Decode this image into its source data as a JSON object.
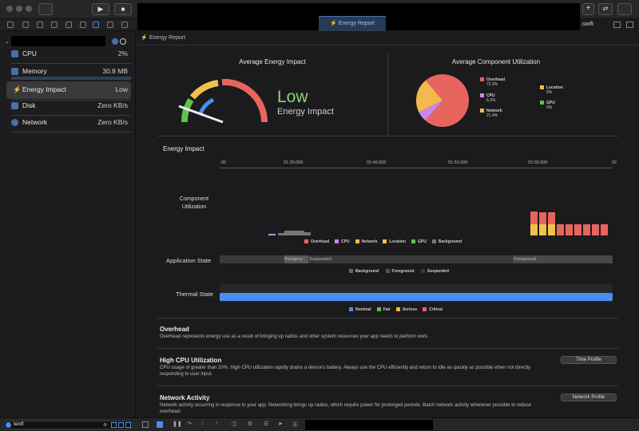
{
  "toolbar": {
    "active_tab": "Energy Report",
    "file_suffix": ".swift"
  },
  "header": {
    "title": "Energy Report"
  },
  "sidebar": {
    "gauges": [
      {
        "label": "CPU",
        "value": "2%"
      },
      {
        "label": "Memory",
        "value": "30.8 MB"
      },
      {
        "label": "Energy Impact",
        "value": "Low"
      },
      {
        "label": "Disk",
        "value": "Zero KB/s"
      },
      {
        "label": "Network",
        "value": "Zero KB/s"
      }
    ],
    "filter_text": "textf"
  },
  "avg_energy": {
    "title": "Average Energy Impact",
    "level": "Low",
    "caption": "Energy Impact"
  },
  "avg_component": {
    "title": "Average Component Utilization",
    "legend": [
      {
        "name": "Overhead",
        "pct": "72.3%",
        "color": "#e8655d"
      },
      {
        "name": "Location",
        "pct": "0%",
        "color": "#f0c24a"
      },
      {
        "name": "CPU",
        "pct": "6.3%",
        "color": "#c985f0"
      },
      {
        "name": "GPU",
        "pct": "0%",
        "color": "#5fc24f"
      },
      {
        "name": "Network",
        "pct": "21.4%",
        "color": "#f3b94f"
      }
    ]
  },
  "chart_data": {
    "type": "pie",
    "title": "Average Component Utilization",
    "categories": [
      "Overhead",
      "CPU",
      "Network",
      "Location",
      "GPU"
    ],
    "values": [
      72.3,
      6.3,
      21.4,
      0,
      0
    ]
  },
  "timeline": {
    "title": "Energy Impact",
    "ticks": [
      "-00",
      "01:30.000",
      "01:40.000",
      "01:50.000",
      "02:00.000",
      "02"
    ],
    "component_label": "Component Utilization",
    "component_legend": [
      "Overhead",
      "CPU",
      "Network",
      "Location",
      "GPU",
      "Background"
    ],
    "app_state_label": "Application State",
    "app_state_segments": [
      "Backgrou",
      "Suspended",
      "Foreground"
    ],
    "app_state_legend": [
      "Background",
      "Foreground",
      "Suspended"
    ],
    "thermal_label": "Thermal State",
    "thermal_legend": [
      "Nominal",
      "Fair",
      "Serious",
      "Critical"
    ]
  },
  "descriptions": [
    {
      "title": "Overhead",
      "text": "Overhead represents energy use as a result of bringing up radios and other system resources your app needs to perform work.",
      "button": ""
    },
    {
      "title": "High CPU Utilization",
      "text": "CPU usage of greater than 20%. High CPU utilization rapidly drains a device's battery. Always use the CPU efficiently and return to idle as quickly as possible when not directly responding to user input.",
      "button": "Time Profile"
    },
    {
      "title": "Network Activity",
      "text": "Network activity occurring in response to your app. Networking brings up radios, which require power for prolonged periods. Batch network activity whenever possible to reduce overhead.",
      "button": "Network Profile"
    }
  ]
}
